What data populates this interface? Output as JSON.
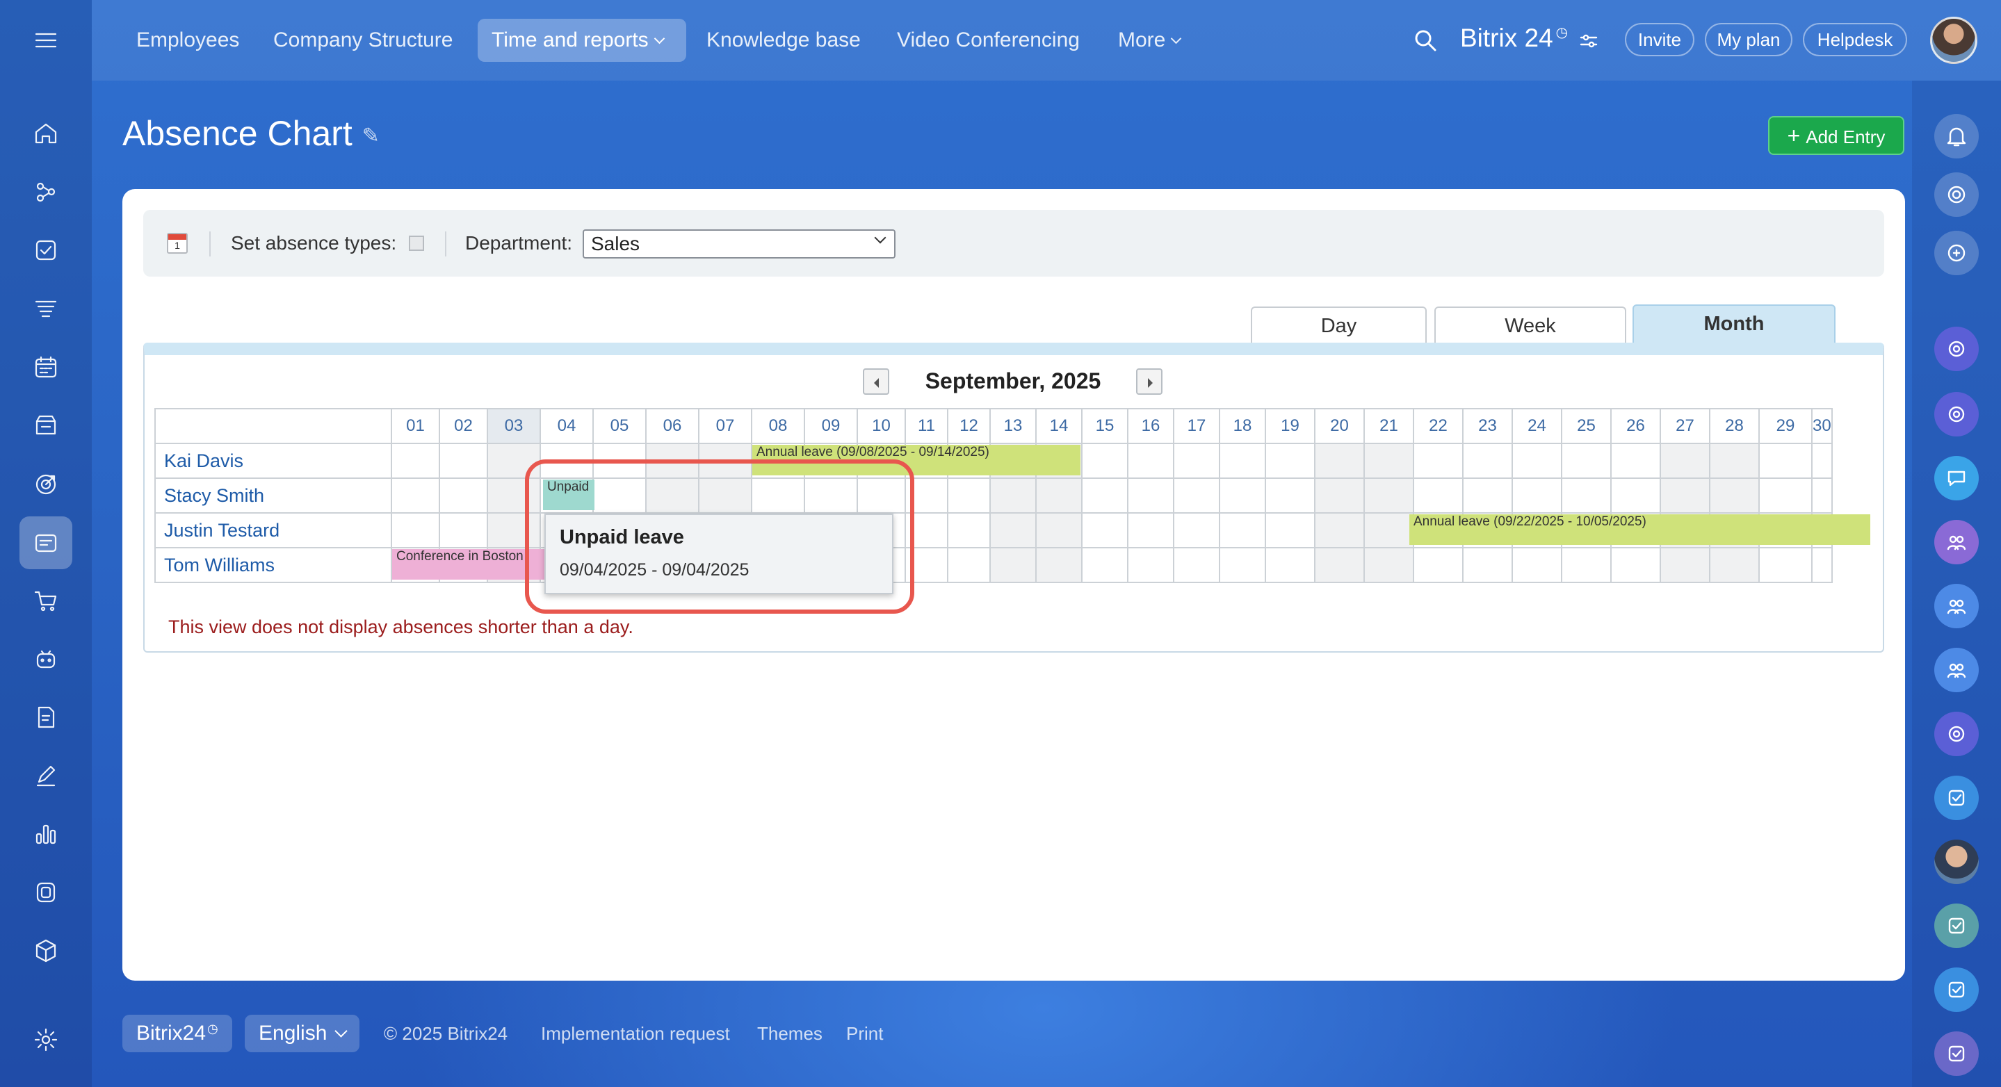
{
  "topnav": {
    "items": [
      "Employees",
      "Company Structure",
      "Time and reports",
      "Knowledge base",
      "Video Conferencing",
      "More"
    ],
    "active": "Time and reports",
    "brand": "Bitrix 24",
    "invite": "Invite",
    "my_plan": "My plan",
    "helpdesk": "Helpdesk"
  },
  "page": {
    "title": "Absence Chart",
    "add_entry": "Add Entry"
  },
  "filter": {
    "absence_types_label": "Set absence types:",
    "department_label": "Department:",
    "department_value": "Sales"
  },
  "view_tabs": {
    "day": "Day",
    "week": "Week",
    "month": "Month",
    "selected": "Month"
  },
  "calendar": {
    "month_label": "September, 2025",
    "days": [
      "01",
      "02",
      "03",
      "04",
      "05",
      "06",
      "07",
      "08",
      "09",
      "10",
      "11",
      "12",
      "13",
      "14",
      "15",
      "16",
      "17",
      "18",
      "19",
      "20",
      "21",
      "22",
      "23",
      "24",
      "25",
      "26",
      "27",
      "28",
      "29",
      "30"
    ],
    "employees": [
      "Kai Davis",
      "Stacy Smith",
      "Justin Testard",
      "Tom Williams"
    ],
    "absences": [
      {
        "employee": "Kai Davis",
        "label": "Annual leave (09/08/2025 - 09/14/2025)",
        "color": "#cfe27a"
      },
      {
        "employee": "Stacy Smith",
        "label": "Unpaid",
        "color": "#9ed9cf"
      },
      {
        "employee": "Justin Testard",
        "label": "Annual leave (09/22/2025 - 10/05/2025)",
        "color": "#cfe27a"
      },
      {
        "employee": "Tom Williams",
        "label": "Conference in Boston",
        "color": "#eeb0d6"
      }
    ],
    "notice": "This view does not display absences shorter than a day."
  },
  "tooltip": {
    "title": "Unpaid leave",
    "dates": "09/04/2025 - 09/04/2025"
  },
  "footer": {
    "brand": "Bitrix24",
    "language": "English",
    "copyright": "© 2025 Bitrix24",
    "implementation": "Implementation request",
    "themes": "Themes",
    "print": "Print"
  }
}
